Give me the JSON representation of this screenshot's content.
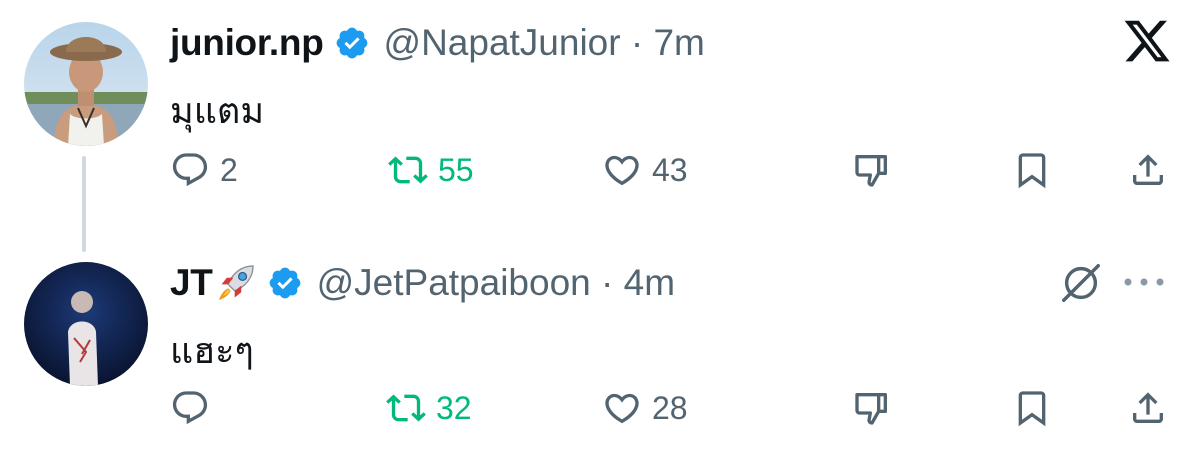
{
  "tweets": [
    {
      "display_name": "junior.np",
      "handle_time": "@NapatJunior · 7m",
      "text": "มุแตม",
      "replies": "2",
      "retweets": "55",
      "likes": "43"
    },
    {
      "display_name": "JT",
      "handle_time": "@JetPatpaiboon · 4m",
      "text": "แฮะๆ",
      "replies": "",
      "retweets": "32",
      "likes": "28"
    }
  ],
  "icons": {
    "reply": "reply-icon",
    "retweet": "retweet-icon",
    "like": "heart-icon",
    "dislike": "dislike-icon",
    "bookmark": "bookmark-icon",
    "share": "share-icon",
    "verified": "verified-badge-icon",
    "brand": "x-logo-icon",
    "grok": "grok-icon",
    "more": "more-icon",
    "emoji": "rocket-icon"
  },
  "colors": {
    "text": "#0f1419",
    "secondary": "#536471",
    "retweet_green": "#00ba7c",
    "verified_blue": "#1d9bf0",
    "thread_line": "#cfd9de"
  }
}
